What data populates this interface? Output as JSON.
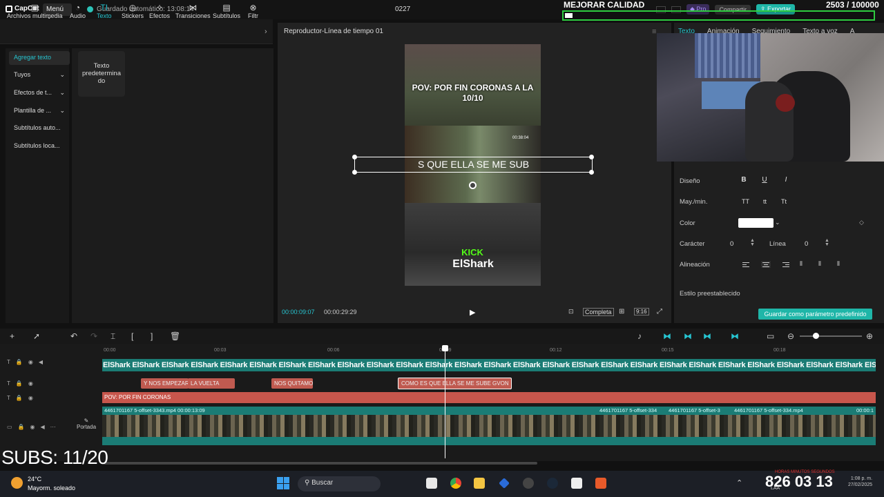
{
  "app": {
    "logo": "CapCut",
    "menu_label": "Menú",
    "autosave": "Guardado automático: 13:08:14",
    "project_title": "0227",
    "pro_label": "Pro",
    "compartir_label": "Compartir",
    "exportar_label": "Exportar"
  },
  "overlay": {
    "mejorar": "MEJORAR CALIDAD",
    "sub_count": "2503 / 100000",
    "progress_fraction": 0.025,
    "subs_counter": "SUBS: 11/20"
  },
  "tool_tabs": [
    {
      "label": "Archivos multimedia",
      "icon": "media-icon"
    },
    {
      "label": "Audio",
      "icon": "audio-icon"
    },
    {
      "label": "Texto",
      "icon": "text-icon",
      "active": true
    },
    {
      "label": "Stickers",
      "icon": "sticker-icon"
    },
    {
      "label": "Efectos",
      "icon": "effects-icon"
    },
    {
      "label": "Transiciones",
      "icon": "transitions-icon"
    },
    {
      "label": "Subtítulos",
      "icon": "subtitles-icon"
    },
    {
      "label": "Filtr",
      "icon": "filters-icon"
    }
  ],
  "left_nav": [
    {
      "label": "Agregar texto",
      "active": true
    },
    {
      "label": "Tuyos",
      "caret": true
    },
    {
      "label": "Efectos de t...",
      "caret": true
    },
    {
      "label": "Plantilla de ...",
      "caret": true
    },
    {
      "label": "Subtítulos auto...",
      "caret": false
    },
    {
      "label": "Subtítulos loca...",
      "caret": false
    }
  ],
  "default_text_card": "Texto predetermina do",
  "player": {
    "title": "Reproductor-Línea de tiempo 01",
    "overlay_top": "POV: POR FIN CORONAS A LA 10/10",
    "video_timestamp": "00:38:04",
    "caption": "S QUE ELLA SE ME SUB",
    "kick": "KICK",
    "channel": "ElShark",
    "current_time": "00:00:09:07",
    "total_time": "00:00:29:29",
    "completa_label": "Completa",
    "ratio_label": "9:16"
  },
  "right_panel": {
    "tabs": [
      "Texto",
      "Animación",
      "Seguimiento",
      "Texto a voz",
      "A"
    ],
    "active_tab": "Texto",
    "diseno_label": "Diseño",
    "mayus_label": "May./min.",
    "case_options": [
      "TT",
      "tt",
      "Tt"
    ],
    "color_label": "Color",
    "color_value": "#ffffff",
    "caracter_label": "Carácter",
    "caracter_value": "0",
    "linea_label": "Línea",
    "linea_value": "0",
    "alineacion_label": "Alineación",
    "preset_label": "Estilo preestablecido",
    "save_preset_label": "Guardar como parámetro predefinido"
  },
  "timeline": {
    "ticks": [
      "00:00",
      "00:03",
      "00:06",
      "00:09",
      "00:12",
      "00:15",
      "00:18"
    ],
    "elshark_track": "ElShark ElShark ElShark ElShark ElShark ElShark ElShark ElShark ElShark ElShark ElShark ElShark ElShark ElShark ElShark ElShark ElShark ElShark ElShark ElShark ElShark ElShark ElShark ElShark ElShark ElShark ElShark ElShark",
    "subtitle_clips": [
      "Y NOS EMPEZAR",
      "LA VUELTA",
      "NOS QUITAMO",
      "COMO ES QUE ELLA SE ME SUBE GVON"
    ],
    "pov_clip": "POV: POR FIN CORONAS",
    "video_clip_label": "4461701167 5-offset-3343.mp4  00:00:13:09",
    "video_clip_label_2": "4461701167 5-offset-334",
    "video_clip_label_3": "4461701167 5-offset-3",
    "video_clip_label_4": "4461701167 5-offset-334.mp4",
    "video_clip_label_5": "00:00:1",
    "portada_label": "Portada"
  },
  "taskbar": {
    "temp": "24°C",
    "weather": "Mayorm. soleado",
    "search": "Buscar",
    "clock_big": "826 03 13",
    "clock_time": "1:08 p. m.",
    "clock_date": "27/02/2025",
    "clock_tags": "HORAS MINUTOS SEGUNDOS",
    "lang": "LAA"
  }
}
